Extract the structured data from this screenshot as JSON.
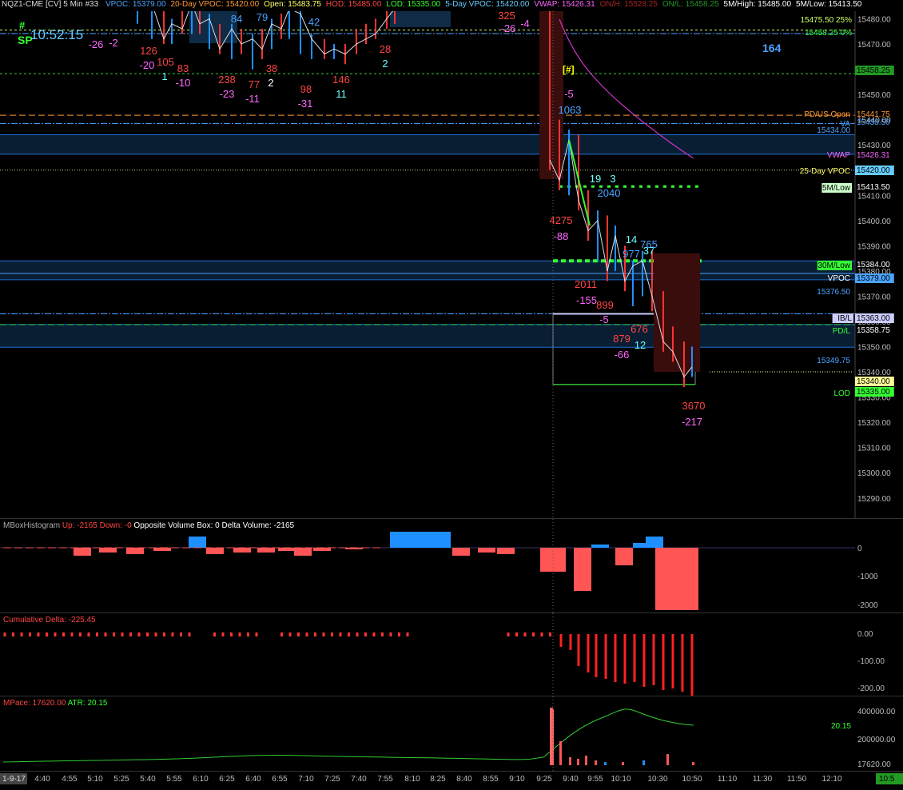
{
  "header": {
    "symbol": "NQZ1-CME [CV]  5 Min  #33",
    "items": [
      {
        "text": "VPOC: 15379.00",
        "color": "#4aa3ff"
      },
      {
        "text": "20-Day VPOC: 15420.00",
        "color": "#ff9933"
      },
      {
        "text": "Open: 15483.75",
        "color": "#ffff66"
      },
      {
        "text": "HOD: 15485.00",
        "color": "#ff4444"
      },
      {
        "text": "LOD: 15335.00",
        "color": "#33ff33"
      },
      {
        "text": "5-Day VPOC: 15420.00",
        "color": "#66ccff"
      },
      {
        "text": "VWAP: 15426.31",
        "color": "#ff66ff"
      },
      {
        "text": "ON/H: 15528.25",
        "color": "#aa2222"
      },
      {
        "text": "ON/L: 15458.25",
        "color": "#229922"
      },
      {
        "text": "5M/High: 15485.00",
        "color": "#ffffff"
      },
      {
        "text": "5M/Low: 15413.50",
        "color": "#ffffff"
      }
    ]
  },
  "clock": "10:52:15",
  "marker_hash": "#",
  "marker_sp": "SP",
  "marker_bracket": "[#]",
  "big_number": "164",
  "price_axis": {
    "ticks": [
      "15480.00",
      "15470.00",
      "15460.00",
      "15450.00",
      "15440.00",
      "15430.00",
      "15420.00",
      "15410.00",
      "15400.00",
      "15390.00",
      "15380.00",
      "15370.00",
      "15360.00",
      "15350.00",
      "15340.00",
      "15330.00",
      "15320.00",
      "15310.00",
      "15300.00",
      "15290.00"
    ],
    "tags": [
      {
        "text": "15475.50 25%",
        "color": "#ccff66",
        "bg": ""
      },
      {
        "text": "15458.25 0%",
        "color": "#33ff33",
        "bg": ""
      },
      {
        "text": "15458.25",
        "color": "#000000",
        "bg": "#229922"
      },
      {
        "text": "PD/US Open",
        "color": "#ff9933",
        "bg": ""
      },
      {
        "text": "15441.75",
        "color": "#ff9933",
        "bg": ""
      },
      {
        "text": "VA",
        "color": "#4aa3ff",
        "bg": ""
      },
      {
        "text": "15438.50",
        "color": "#4aa3ff",
        "bg": ""
      },
      {
        "text": "15434.00",
        "color": "#4aa3ff",
        "bg": ""
      },
      {
        "text": "VWAP",
        "color": "#ff66ff",
        "bg": ""
      },
      {
        "text": "15426.31",
        "color": "#ff66ff",
        "bg": ""
      },
      {
        "text": "25-Day VPOC",
        "color": "#ffff66",
        "bg": ""
      },
      {
        "text": "15420.00",
        "color": "#000000",
        "bg": "#66ccff"
      },
      {
        "text": "5M/Low",
        "color": "#000000",
        "bg": "#ccffcc"
      },
      {
        "text": "15413.50",
        "color": "#ffffff",
        "bg": ""
      },
      {
        "text": "30M/Low",
        "color": "#000000",
        "bg": "#33ff33"
      },
      {
        "text": "15384.00",
        "color": "#ffffff",
        "bg": ""
      },
      {
        "text": "VPOC",
        "color": "#ffffff",
        "bg": ""
      },
      {
        "text": "15379.00",
        "color": "#000000",
        "bg": "#4aa3ff"
      },
      {
        "text": "15376.50",
        "color": "#4aa3ff",
        "bg": ""
      },
      {
        "text": "IB/L",
        "color": "#000000",
        "bg": "#ccccff"
      },
      {
        "text": "15363.00",
        "color": "#000000",
        "bg": "#ccccff"
      },
      {
        "text": "PD/L",
        "color": "#33ff33",
        "bg": ""
      },
      {
        "text": "15358.75",
        "color": "#ffffff",
        "bg": ""
      },
      {
        "text": "15349.75",
        "color": "#4aa3ff",
        "bg": ""
      },
      {
        "text": "15340.00",
        "color": "#000000",
        "bg": "#ffff99"
      },
      {
        "text": "LOD",
        "color": "#33ff33",
        "bg": ""
      },
      {
        "text": "15335.00",
        "color": "#000000",
        "bg": "#33ff33"
      }
    ]
  },
  "candle_numbers": [
    {
      "text": "126",
      "c": "#ff4444"
    },
    {
      "text": "-20",
      "c": "#ff66ff"
    },
    {
      "text": "105",
      "c": "#ff4444"
    },
    {
      "text": "1",
      "c": "#66ffff"
    },
    {
      "text": "83",
      "c": "#ff4444"
    },
    {
      "text": "-10",
      "c": "#ff66ff"
    },
    {
      "text": "238",
      "c": "#ff4444"
    },
    {
      "text": "-23",
      "c": "#ff66ff"
    },
    {
      "text": "77",
      "c": "#ff4444"
    },
    {
      "text": "-11",
      "c": "#ff66ff"
    },
    {
      "text": "38",
      "c": "#ff4444"
    },
    {
      "text": "2",
      "c": "#ffffff"
    },
    {
      "text": "98",
      "c": "#ff4444"
    },
    {
      "text": "-31",
      "c": "#ff66ff"
    },
    {
      "text": "146",
      "c": "#ff4444"
    },
    {
      "text": "11",
      "c": "#66ffff"
    },
    {
      "text": "28",
      "c": "#ff4444"
    },
    {
      "text": "2",
      "c": "#66ffff"
    },
    {
      "text": "84",
      "c": "#4aa3ff"
    },
    {
      "text": "79",
      "c": "#4aa3ff"
    },
    {
      "text": "42",
      "c": "#4aa3ff"
    },
    {
      "text": "-26",
      "c": "#ff66ff"
    },
    {
      "text": "-2",
      "c": "#ff66ff"
    },
    {
      "text": "325",
      "c": "#ff4444"
    },
    {
      "text": "-26",
      "c": "#ff66ff"
    },
    {
      "text": "-4",
      "c": "#ff66ff"
    },
    {
      "text": "-5",
      "c": "#ff66ff"
    },
    {
      "text": "1063",
      "c": "#4aa3ff"
    },
    {
      "text": "19",
      "c": "#66ffff"
    },
    {
      "text": "3",
      "c": "#66ffff"
    },
    {
      "text": "2040",
      "c": "#4aa3ff"
    },
    {
      "text": "4275",
      "c": "#ff4444"
    },
    {
      "text": "-88",
      "c": "#ff66ff"
    },
    {
      "text": "14",
      "c": "#66ffff"
    },
    {
      "text": "977",
      "c": "#4aa3ff"
    },
    {
      "text": "37",
      "c": "#66ffff"
    },
    {
      "text": "765",
      "c": "#4aa3ff"
    },
    {
      "text": "2011",
      "c": "#ff4444"
    },
    {
      "text": "-155",
      "c": "#ff66ff"
    },
    {
      "text": "899",
      "c": "#ff4444"
    },
    {
      "text": "-5",
      "c": "#ff66ff"
    },
    {
      "text": "676",
      "c": "#ff4444"
    },
    {
      "text": "879",
      "c": "#ff4444"
    },
    {
      "text": "12",
      "c": "#66ffff"
    },
    {
      "text": "-66",
      "c": "#ff66ff"
    },
    {
      "text": "3670",
      "c": "#ff4444"
    },
    {
      "text": "-217",
      "c": "#ff66ff"
    }
  ],
  "hist": {
    "title": "MBoxHistogram",
    "up": "Up: -2165",
    "down": "Down: -0",
    "opp": "Opposite Volume Box: 0",
    "delta": "Delta Volume: -2165",
    "ticks": [
      "0",
      "-1000",
      "-2000"
    ]
  },
  "cum": {
    "title": "Cumulative Delta: -225.45",
    "ticks": [
      "0.00",
      "-100.00",
      "-200.00"
    ]
  },
  "pace": {
    "title": "MPace: 17620.00",
    "atr": "ATR: 20.15",
    "atr_value": "20.15",
    "ticks": [
      "400000.00",
      "200000.00",
      "17620.00"
    ]
  },
  "time_axis": {
    "start_label": "1-9-17",
    "ticks": [
      "4:40",
      "4:55",
      "5:10",
      "5:25",
      "5:40",
      "5:55",
      "6:10",
      "6:25",
      "6:40",
      "6:55",
      "7:10",
      "7:25",
      "7:40",
      "7:55",
      "8:10",
      "8:25",
      "8:40",
      "8:55",
      "9:10",
      "9:25",
      "9:40",
      "9:55",
      "10:10",
      "10:30",
      "10:50",
      "11:10",
      "11:30",
      "11:50",
      "12:10"
    ],
    "end_label": "10:5"
  },
  "colors": {
    "up": "#1e90ff",
    "down": "#ff3333",
    "green": "#33ff33",
    "vwap": "#cc33cc",
    "va": "#4aa3ff"
  }
}
